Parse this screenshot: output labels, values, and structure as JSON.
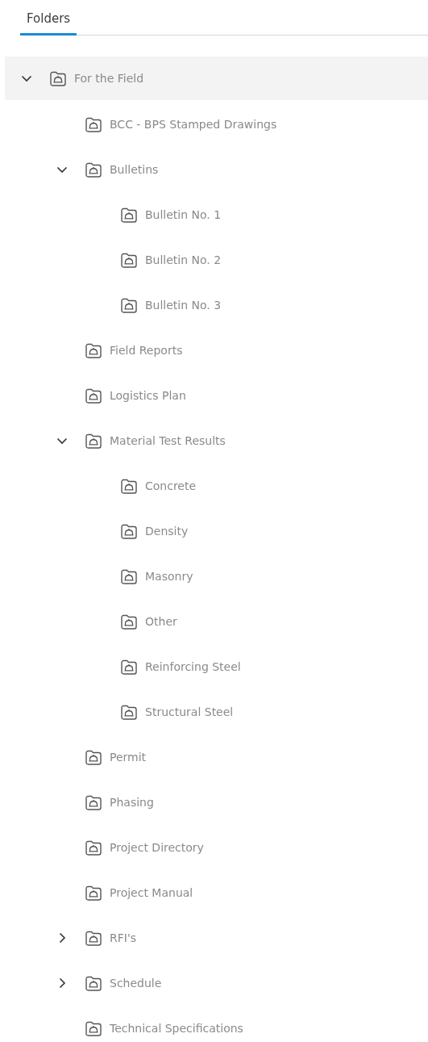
{
  "tabs": [
    {
      "label": "Folders",
      "selected": true
    }
  ],
  "tree": [
    {
      "label": "For the Field",
      "selected": true,
      "expanded": true,
      "children": [
        {
          "label": "BCC - BPS Stamped Drawings",
          "selected": false
        },
        {
          "label": "Bulletins",
          "selected": false,
          "expanded": true,
          "children": [
            {
              "label": "Bulletin No. 1",
              "selected": false
            },
            {
              "label": "Bulletin No. 2",
              "selected": false
            },
            {
              "label": "Bulletin No. 3",
              "selected": false
            }
          ]
        },
        {
          "label": "Field Reports",
          "selected": false
        },
        {
          "label": "Logistics Plan",
          "selected": false
        },
        {
          "label": "Material Test Results",
          "selected": false,
          "expanded": true,
          "children": [
            {
              "label": "Concrete",
              "selected": false
            },
            {
              "label": "Density",
              "selected": false
            },
            {
              "label": "Masonry",
              "selected": false
            },
            {
              "label": "Other",
              "selected": false
            },
            {
              "label": "Reinforcing Steel",
              "selected": false
            },
            {
              "label": "Structural Steel",
              "selected": false
            }
          ]
        },
        {
          "label": "Permit",
          "selected": false
        },
        {
          "label": "Phasing",
          "selected": false
        },
        {
          "label": "Project Directory",
          "selected": false
        },
        {
          "label": "Project Manual",
          "selected": false
        },
        {
          "label": "RFI's",
          "selected": false,
          "expanded": false
        },
        {
          "label": "Schedule",
          "selected": false,
          "expanded": false
        },
        {
          "label": "Technical Specifications",
          "selected": false
        }
      ]
    }
  ]
}
